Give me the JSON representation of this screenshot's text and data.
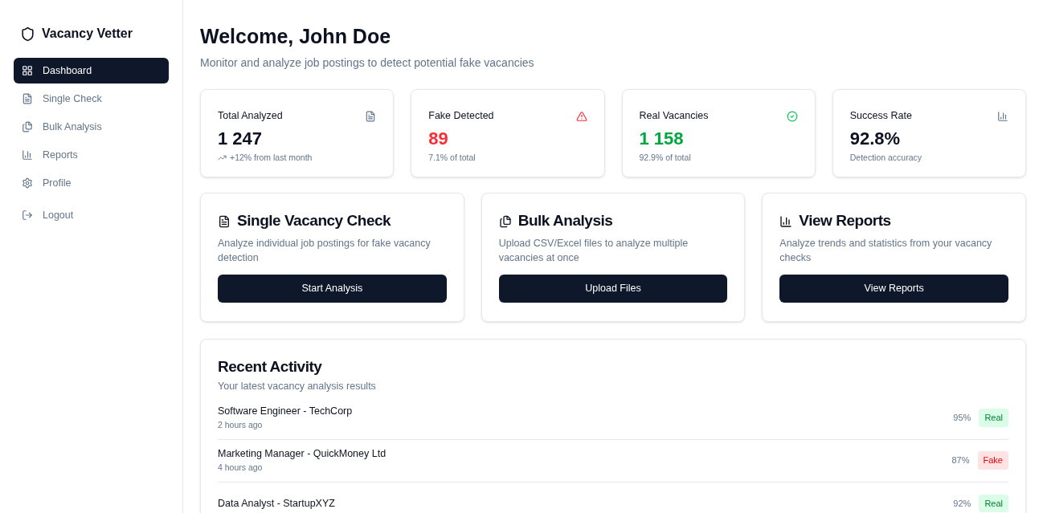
{
  "sidebar": {
    "title": "Vacancy Vetter",
    "items": [
      {
        "label": "Dashboard",
        "kind": "grid",
        "selected": true
      },
      {
        "label": "Single Check",
        "kind": "file",
        "selected": false
      },
      {
        "label": "Bulk Analysis",
        "kind": "files",
        "selected": false
      },
      {
        "label": "Reports",
        "kind": "chart",
        "selected": false
      },
      {
        "label": "Profile",
        "kind": "gear",
        "selected": false
      },
      {
        "label": "Logout",
        "kind": "logout",
        "selected": false
      }
    ]
  },
  "header": {
    "title": "Welcome, John Doe",
    "subtitle": "Monitor and analyze job postings to detect potential fake vacancies"
  },
  "stats": [
    {
      "kind": "total",
      "label": "Total Analyzed",
      "value": "1 247",
      "note": "+12% from last month"
    },
    {
      "kind": "fake",
      "label": "Fake Detected",
      "value": "89",
      "note": "7.1% of total"
    },
    {
      "kind": "real",
      "label": "Real Vacancies",
      "value": "1 158",
      "note": "92.9% of total"
    },
    {
      "kind": "rate",
      "label": "Success Rate",
      "value": "92.8%",
      "note": "Detection accuracy"
    }
  ],
  "actions": [
    {
      "kind": "file",
      "title": "Single Vacancy Check",
      "description": "Analyze individual job postings for fake vacancy detection",
      "button": "Start Analysis"
    },
    {
      "kind": "files",
      "title": "Bulk Analysis",
      "description": "Upload CSV/Excel files to analyze multiple vacancies at once",
      "button": "Upload Files"
    },
    {
      "kind": "chart",
      "title": "View Reports",
      "description": "Analyze trends and statistics from your vacancy checks",
      "button": "View Reports"
    }
  ],
  "recent_activity": {
    "title": "Recent Activity",
    "subtitle": "Your latest vacancy analysis results",
    "rows": [
      {
        "title": "Software Engineer - TechCorp",
        "time": "2 hours ago",
        "score": "95%",
        "status": "Real",
        "kind": "real"
      },
      {
        "title": "Marketing Manager - QuickMoney Ltd",
        "time": "4 hours ago",
        "score": "87%",
        "status": "Fake",
        "kind": "fake"
      },
      {
        "title": "Data Analyst - StartupXYZ",
        "score": "92%",
        "status": "Real",
        "kind": "real"
      }
    ]
  }
}
